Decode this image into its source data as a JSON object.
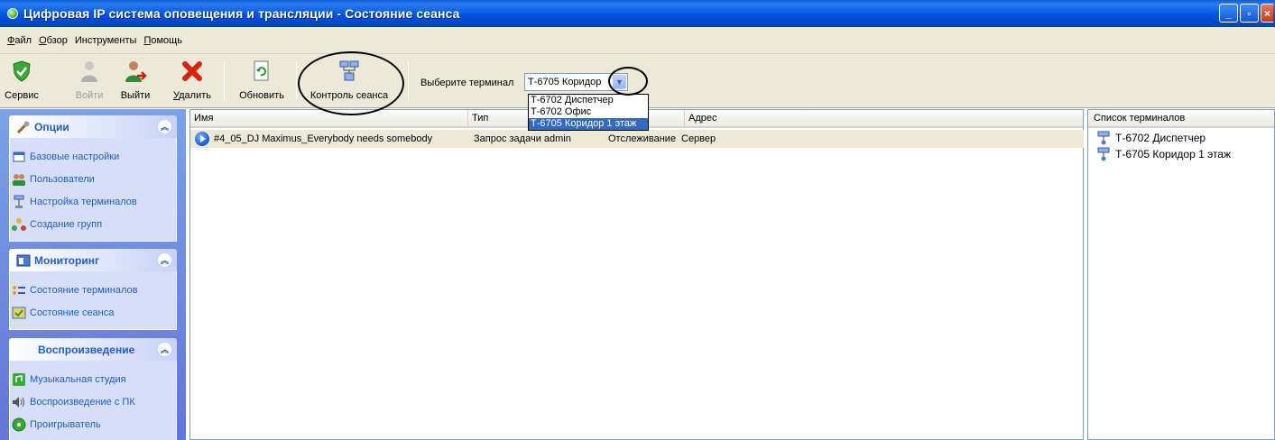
{
  "window": {
    "title": "Цифровая IP система оповещения и трансляции  -  Состояние сеанса",
    "controls": [
      "_",
      "▫",
      "×"
    ]
  },
  "menu": [
    {
      "accel": "Ф",
      "rest": "айл"
    },
    {
      "accel": "О",
      "rest": "бзор"
    },
    {
      "accel": "",
      "rest": "Инструменты"
    },
    {
      "accel": "П",
      "rest": "омощь"
    }
  ],
  "toolbar": {
    "service": "Сервис",
    "login": "Войти",
    "logout": "Выйти",
    "delete": "Удалить",
    "delete_accel": "У",
    "delete_rest": "далить",
    "refresh": "Обновить",
    "session_control": "Контроль сеанса",
    "terminal_label": "Выберите терминал",
    "terminal_value": "Т-6705 Коридор",
    "terminal_options": [
      "Т-6702 Диспетчер",
      "Т-6702 Офис",
      "Т-6705 Коридор 1 этаж"
    ],
    "terminal_selected_index": 2
  },
  "sidebar": {
    "options": {
      "title": "Опции",
      "items": [
        "Базовые настройки",
        "Пользователи",
        "Настройка терминалов",
        "Создание групп"
      ]
    },
    "monitoring": {
      "title": "Мониторинг",
      "items": [
        "Состояние терминалов",
        "Состояние сеанса"
      ]
    },
    "playback": {
      "title": "Воспроизведение",
      "items": [
        "Музыкальная студия",
        "Воспроизведение с ПК",
        "Проигрыватель"
      ]
    }
  },
  "session_table": {
    "columns": [
      "Имя",
      "Тип",
      "",
      "Адрес"
    ],
    "rows": [
      {
        "name": "#4_05_DJ Maximus_Everybody needs somebody",
        "type": "Запрос задачи admin",
        "mode": "Отслеживание",
        "address": "Сервер"
      }
    ]
  },
  "terminals_panel": {
    "title": "Список терминалов",
    "items": [
      "Т-6702 Диспетчер",
      "Т-6705 Коридор 1 этаж"
    ]
  }
}
